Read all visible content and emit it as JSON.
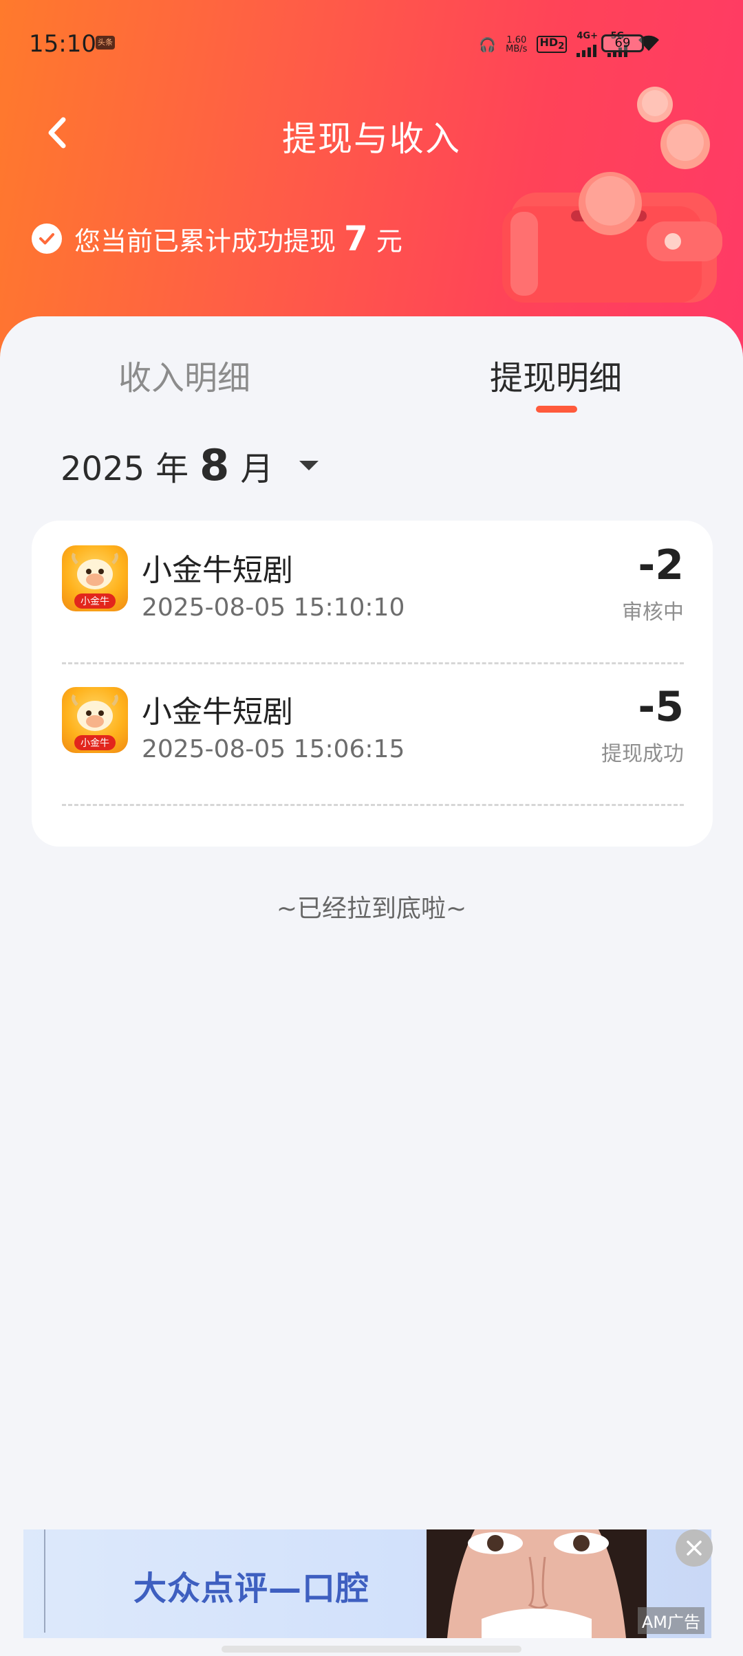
{
  "status_bar": {
    "time": "15:10",
    "badge": "头条",
    "net_speed_value": "1.60",
    "net_speed_unit": "MB/s",
    "hd": "HD",
    "hd_sub": "2",
    "network1": "4G+",
    "network2": "5G",
    "battery": "69"
  },
  "header": {
    "title": "提现与收入",
    "summary_prefix": "您当前已累计成功提现",
    "summary_amount": "7",
    "summary_unit": "元"
  },
  "tabs": [
    {
      "label": "收入明细",
      "active": false
    },
    {
      "label": "提现明细",
      "active": true
    }
  ],
  "month_picker": {
    "year": "2025",
    "year_unit": "年",
    "month": "8",
    "month_unit": "月"
  },
  "records": [
    {
      "title": "小金牛短剧",
      "time": "2025-08-05 15:10:10",
      "amount": "-2",
      "status": "审核中"
    },
    {
      "title": "小金牛短剧",
      "time": "2025-08-05 15:06:15",
      "amount": "-5",
      "status": "提现成功"
    }
  ],
  "app_icon_text": "小金牛",
  "end_text": "~已经拉到底啦~",
  "ad": {
    "title": "大众点评—口腔",
    "tag": "AM广告"
  },
  "colors": {
    "header_start": "#ff7a2c",
    "header_end": "#ff3a66",
    "accent": "#ff5a3c"
  }
}
